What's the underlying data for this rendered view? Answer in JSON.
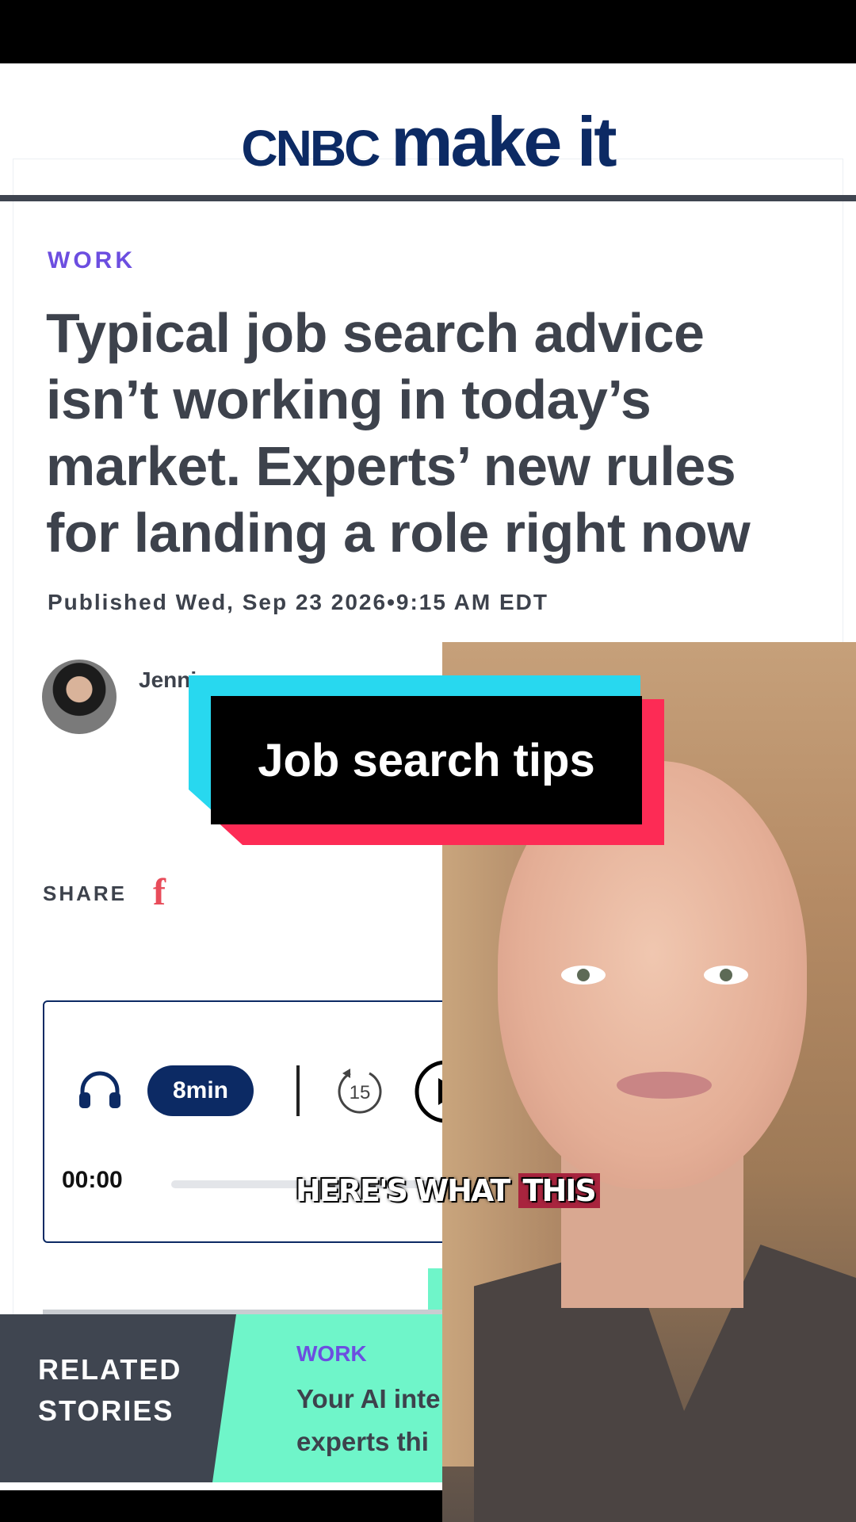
{
  "brand": {
    "cnbc": "CNBC",
    "makeit": "make it"
  },
  "article": {
    "section": "WORK",
    "headline": "Typical job search advice isn’t working in today’s market. Experts’ new rules for landing a role right now",
    "published": "Published Wed, Sep 23 2026•9:15 AM EDT",
    "author": "Jenni"
  },
  "share": {
    "label": "SHARE",
    "facebook_glyph": "f"
  },
  "player": {
    "duration": "8min",
    "rewind_seconds": "15",
    "current_time": "00:00",
    "progress": 0
  },
  "related": {
    "label": "RELATED STORIES",
    "section": "WORK",
    "title": "Your AI inte experts thi"
  },
  "overlay": {
    "title": "Job search tips"
  },
  "caption": {
    "text_plain": "HERE'S WHAT ",
    "text_highlight": "THIS"
  },
  "colors": {
    "navy": "#0c2a64",
    "purple": "#6c4ee0",
    "mint": "#6ff5c9",
    "cyan": "#28d8ef",
    "red": "#fd2b55"
  }
}
